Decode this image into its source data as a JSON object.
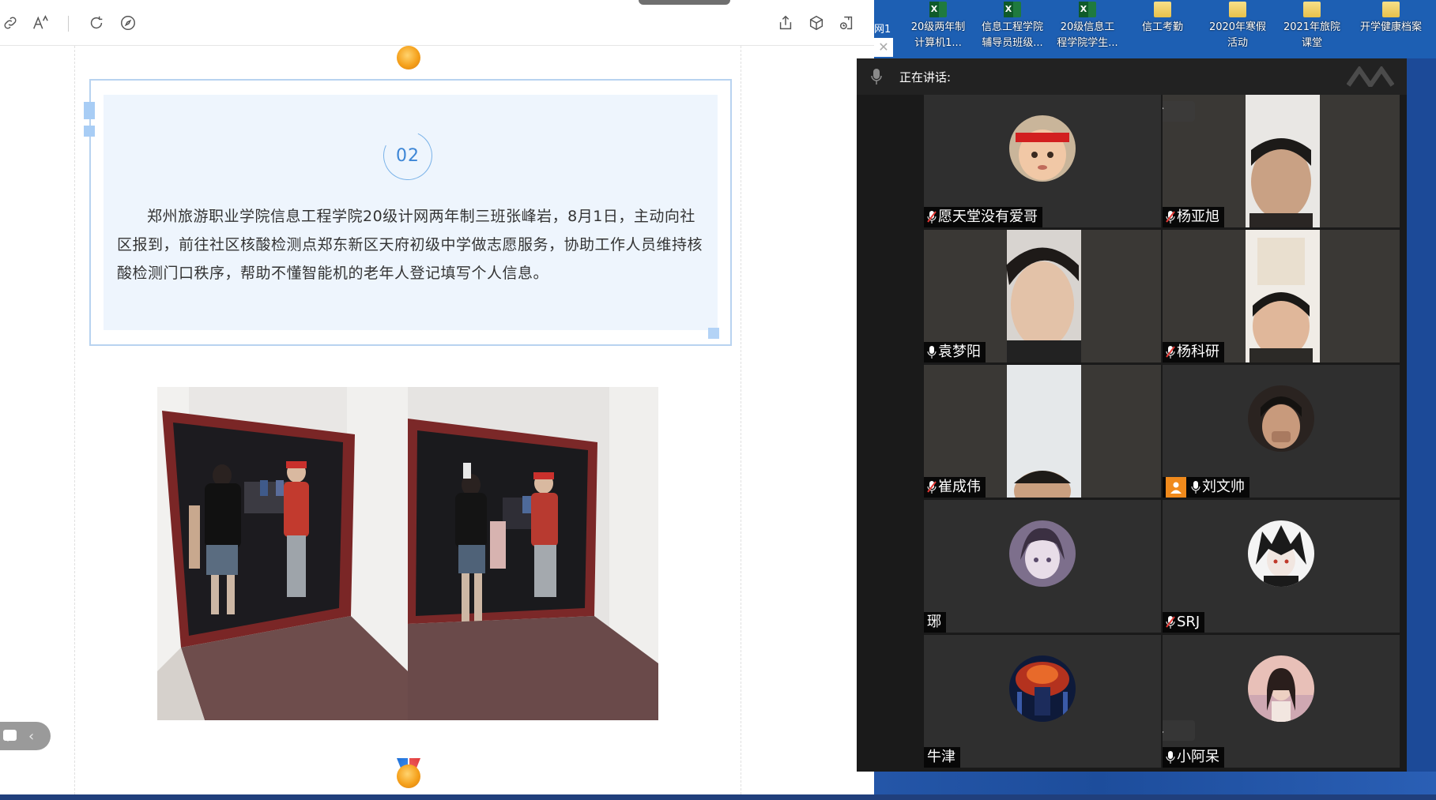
{
  "editor": {
    "toolbar": {
      "link_icon": "link-icon",
      "font_icon": "font-size-icon",
      "refresh_icon": "refresh-icon",
      "compass_icon": "compass-icon",
      "share_icon": "share-icon",
      "cube_icon": "cube-icon",
      "export_icon": "export-icon"
    },
    "card": {
      "number": "02",
      "paragraph": "郑州旅游职业学院信息工程学院20级计网两年制三班张峰岩，8月1日，主动向社区报到，前往社区核酸检测点郑东新区天府初级中学做志愿服务，协助工作人员维持核酸检测门口秩序，帮助不懂智能机的老年人登记填写个人信息。"
    },
    "photos_count": 2
  },
  "desktop": {
    "items": [
      {
        "label_line1": "20级两年制",
        "label_line2": "计算机1...",
        "type": "xls"
      },
      {
        "label_line1": "信息工程学院",
        "label_line2": "辅导员班级...",
        "type": "xls"
      },
      {
        "label_line1": "20级信息工",
        "label_line2": "程学院学生...",
        "type": "xls"
      },
      {
        "label_line1": "信工考勤",
        "label_line2": "",
        "type": "folder"
      },
      {
        "label_line1": "2020年寒假",
        "label_line2": "活动",
        "type": "folder"
      },
      {
        "label_line1": "2021年旅院",
        "label_line2": "课堂",
        "type": "folder"
      },
      {
        "label_line1": "开学健康档案",
        "label_line2": "",
        "type": "folder"
      }
    ],
    "left_fragment": "网1"
  },
  "meeting": {
    "speaking_label": "正在讲话:",
    "participants": [
      {
        "name": "愿天堂没有爱哥",
        "muted": true,
        "kind": "avatar-baby"
      },
      {
        "name": "杨亚旭",
        "muted": true,
        "kind": "video"
      },
      {
        "name": "袁梦阳",
        "muted": false,
        "kind": "video"
      },
      {
        "name": "杨科研",
        "muted": true,
        "kind": "video"
      },
      {
        "name": "崔成伟",
        "muted": true,
        "kind": "video"
      },
      {
        "name": "刘文帅",
        "muted": false,
        "host": true,
        "kind": "avatar-face"
      },
      {
        "name": "琊",
        "muted": null,
        "kind": "avatar-anime1"
      },
      {
        "name": "SRJ",
        "muted": true,
        "kind": "avatar-anime2"
      },
      {
        "name": "牛津",
        "muted": null,
        "kind": "avatar-fire"
      },
      {
        "name": "小阿呆",
        "muted": false,
        "kind": "avatar-girl"
      }
    ]
  },
  "colors": {
    "card_border": "#b8d3f0",
    "card_fill": "#eef5fd",
    "accent_blue": "#3d86d6",
    "meeting_bg": "#1a1a1a",
    "desktop_blue": "#1d5fb3",
    "host_orange": "#f08a1c"
  }
}
